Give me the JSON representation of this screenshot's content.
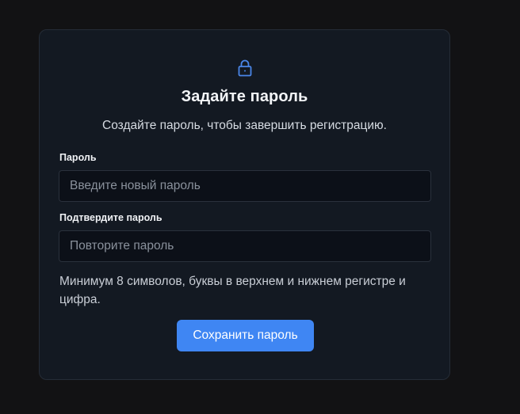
{
  "form": {
    "icon": "lock-icon",
    "title": "Задайте пароль",
    "subtitle": "Создайте пароль, чтобы завершить регистрацию.",
    "password": {
      "label": "Пароль",
      "placeholder": "Введите новый пароль",
      "value": ""
    },
    "confirm": {
      "label": "Подтвердите пароль",
      "placeholder": "Повторите пароль",
      "value": ""
    },
    "hint": "Минимум 8 символов, буквы в верхнем и нижнем регистре и цифра.",
    "submit_label": "Сохранить пароль"
  },
  "colors": {
    "page_background": "#121214",
    "card_background": "#131922",
    "accent": "#3f86f3",
    "icon": "#4a86e8"
  }
}
